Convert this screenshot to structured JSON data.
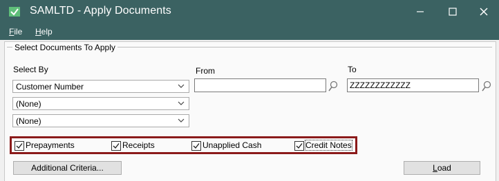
{
  "window": {
    "title": "SAMLTD - Apply Documents",
    "icon": "app-check-icon"
  },
  "window_controls": {
    "minimize": "–",
    "maximize": "☐",
    "close": "✕"
  },
  "menu": {
    "file": {
      "label": "File",
      "mnemonic": "F",
      "rest": "ile"
    },
    "help": {
      "label": "Help",
      "mnemonic": "H",
      "rest": "elp"
    }
  },
  "group": {
    "legend": "Select Documents To Apply"
  },
  "labels": {
    "select_by": "Select By",
    "from": "From",
    "to": "To"
  },
  "select_by_rows": [
    {
      "value": "Customer Number"
    },
    {
      "value": "(None)"
    },
    {
      "value": "(None)"
    }
  ],
  "from_value": "",
  "to_value": "ZZZZZZZZZZZZ",
  "document_types": [
    {
      "label": "Prepayments",
      "checked": true
    },
    {
      "label": "Receipts",
      "checked": true
    },
    {
      "label": "Unapplied Cash",
      "checked": true
    },
    {
      "label": "Credit Notes",
      "checked": true
    }
  ],
  "buttons": {
    "additional_criteria": "Additional Criteria...",
    "load_mnemonic": "L",
    "load_rest": "oad"
  },
  "colors": {
    "titlebar": "#3b6262",
    "highlight": "#8b1a1a"
  }
}
